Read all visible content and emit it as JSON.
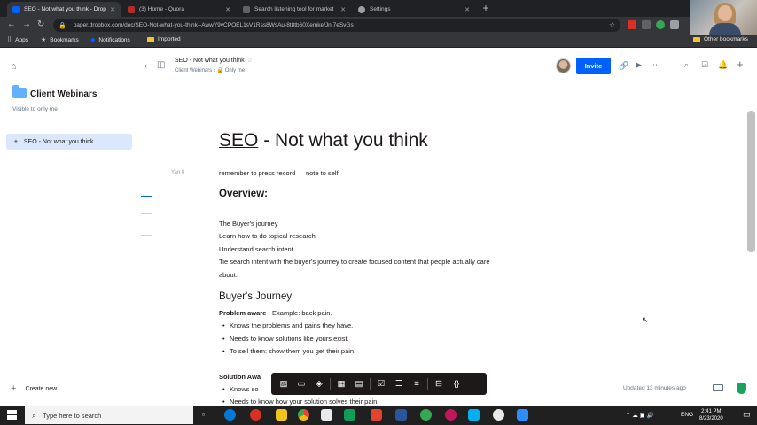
{
  "browser": {
    "tabs": [
      {
        "title": "SEO - Not what you think - Drop",
        "active": true
      },
      {
        "title": "(3) Home - Quora",
        "active": false
      },
      {
        "title": "Search listening tool for market",
        "active": false
      },
      {
        "title": "Settings",
        "active": false
      }
    ],
    "url": "paper.dropbox.com/doc/SEO-Not-what-you-think--AwwY9vCPOEL1sV1Rss8WsAu-8t8tb60Xemke/JnI7eSvGs",
    "bookmarks": [
      {
        "label": "Apps",
        "icon": "apps-grid-icon"
      },
      {
        "label": "Bookmarks",
        "icon": "star-icon"
      },
      {
        "label": "Notifications",
        "icon": "dropbox-icon"
      },
      {
        "label": "Imported",
        "icon": "folder-icon"
      }
    ],
    "other_bookmarks": "Other bookmarks"
  },
  "sidebar": {
    "folder_title": "Client Webinars",
    "folder_visibility": "Visible to only me",
    "doc_item": "SEO - Not what you think",
    "create_new": "Create new"
  },
  "header": {
    "doc_title": "SEO - Not what you think",
    "breadcrumb_folder": "Client Webinars",
    "breadcrumb_sharing": "Only me",
    "invite_label": "Invite"
  },
  "document": {
    "title_word": "SEO",
    "title_rest": " - Not what you think",
    "margin_label": "Yan 8",
    "reminder": "remember to press record — note to self",
    "overview_heading": "Overview:",
    "overview_lines": [
      "The Buyer's journey",
      "Learn how to do topical research",
      "Understand search intent",
      "Tie search intent with the buyer's journey to create focused content that people actually care",
      "about."
    ],
    "buyers_journey_heading": "Buyer's Journey",
    "problem_aware_label": "Problem aware",
    "problem_aware_example": " - Example: back pain.",
    "problem_bullets": [
      "Knows the problems and pains they have.",
      "Needs to know solutions like yours exist.",
      "To sell them: show them you get their pain."
    ],
    "solution_aware_label": "Solution Awa",
    "solution_bullets": [
      "Knows so",
      "Needs to know how your solution solves their pain"
    ],
    "updated": "Updated 13 minutes ago"
  },
  "taskbar": {
    "search_placeholder": "Type here to search",
    "language": "ENG",
    "time": "2:41 PM",
    "date": "8/23/2020"
  },
  "colors": {
    "accent": "#0061fe",
    "folder": "#62b0ff",
    "selected_item_bg": "#dbe8fb"
  }
}
